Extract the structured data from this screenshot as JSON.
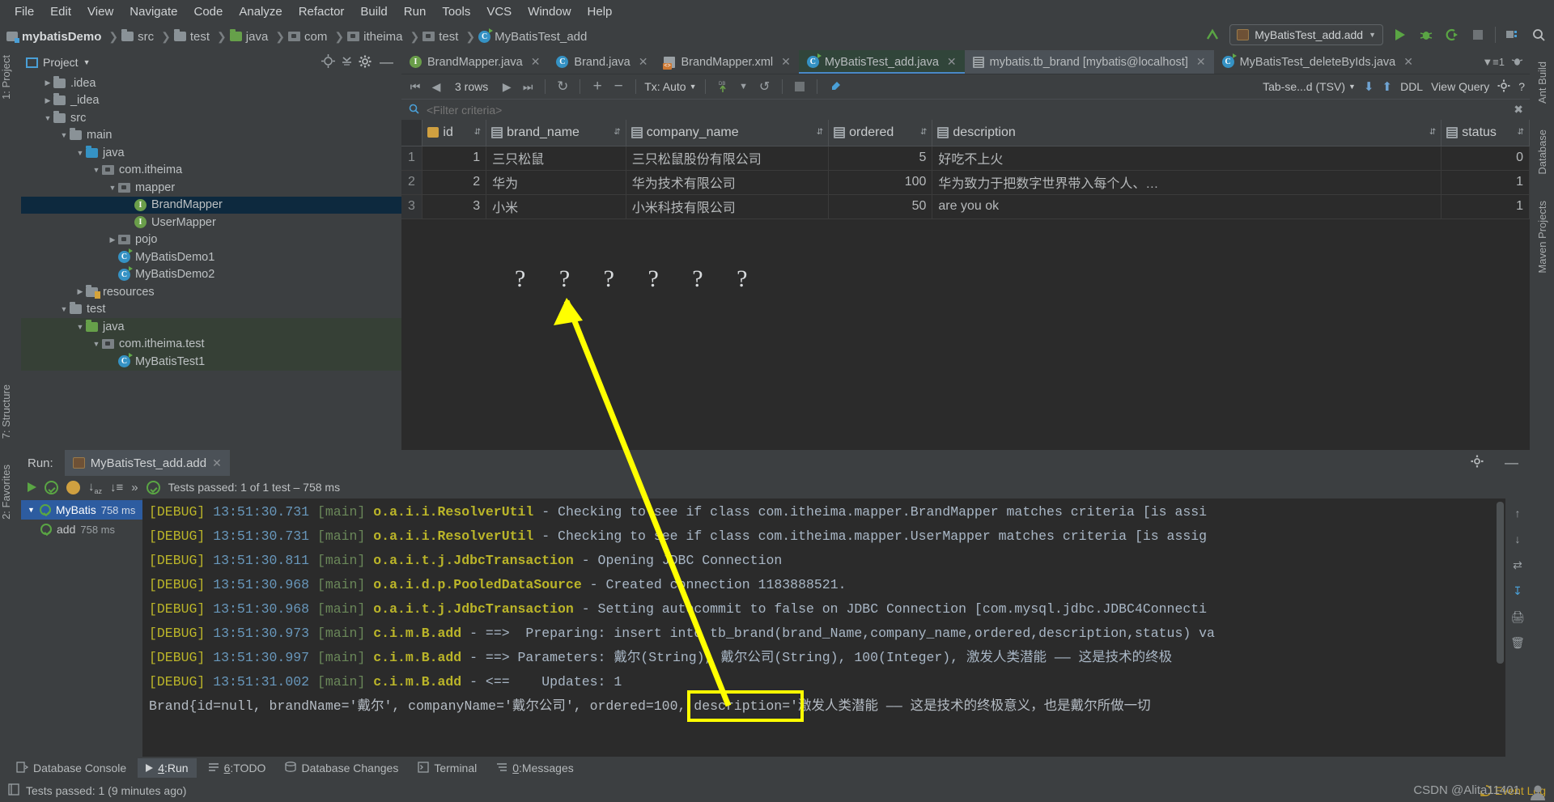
{
  "menubar": {
    "items": [
      "File",
      "Edit",
      "View",
      "Navigate",
      "Code",
      "Analyze",
      "Refactor",
      "Build",
      "Run",
      "Tools",
      "VCS",
      "Window",
      "Help"
    ]
  },
  "breadcrumb": {
    "items": [
      {
        "label": "mybatisDemo",
        "icon": "module-icon"
      },
      {
        "label": "src",
        "icon": "folder-icon"
      },
      {
        "label": "test",
        "icon": "folder-icon"
      },
      {
        "label": "java",
        "icon": "source-folder-icon"
      },
      {
        "label": "com",
        "icon": "package-icon"
      },
      {
        "label": "itheima",
        "icon": "package-icon"
      },
      {
        "label": "test",
        "icon": "package-icon"
      },
      {
        "label": "MyBatisTest_add",
        "icon": "java-class-icon"
      }
    ]
  },
  "toolbar": {
    "run_config": "MyBatisTest_add.add",
    "buttons": [
      "run-button",
      "debug-button",
      "run-coverage-button",
      "stop-button",
      "project-structure-button",
      "search-everywhere-button"
    ]
  },
  "project_panel": {
    "title": "Project",
    "tree": [
      {
        "label": ".idea",
        "depth": 1,
        "arrow": "collapsed",
        "icon": "folder-icon"
      },
      {
        "label": "_idea",
        "depth": 1,
        "arrow": "collapsed",
        "icon": "folder-icon"
      },
      {
        "label": "src",
        "depth": 1,
        "arrow": "expanded",
        "icon": "folder-icon"
      },
      {
        "label": "main",
        "depth": 2,
        "arrow": "expanded",
        "icon": "folder-icon"
      },
      {
        "label": "java",
        "depth": 3,
        "arrow": "expanded",
        "icon": "source-folder-icon"
      },
      {
        "label": "com.itheima",
        "depth": 4,
        "arrow": "expanded",
        "icon": "package-icon"
      },
      {
        "label": "mapper",
        "depth": 5,
        "arrow": "expanded",
        "icon": "package-icon"
      },
      {
        "label": "BrandMapper",
        "depth": 6,
        "arrow": "none",
        "icon": "interface-icon",
        "state": "selected"
      },
      {
        "label": "UserMapper",
        "depth": 6,
        "arrow": "none",
        "icon": "interface-icon"
      },
      {
        "label": "pojo",
        "depth": 5,
        "arrow": "collapsed",
        "icon": "package-icon"
      },
      {
        "label": "MyBatisDemo1",
        "depth": 5,
        "arrow": "none",
        "icon": "java-class-icon"
      },
      {
        "label": "MyBatisDemo2",
        "depth": 5,
        "arrow": "none",
        "icon": "java-class-icon"
      },
      {
        "label": "resources",
        "depth": 3,
        "arrow": "collapsed",
        "icon": "resources-folder-icon"
      },
      {
        "label": "test",
        "depth": 2,
        "arrow": "expanded",
        "icon": "folder-icon"
      },
      {
        "label": "java",
        "depth": 3,
        "arrow": "expanded",
        "icon": "test-source-folder-icon",
        "state": "test"
      },
      {
        "label": "com.itheima.test",
        "depth": 4,
        "arrow": "expanded",
        "icon": "package-icon",
        "state": "test"
      },
      {
        "label": "MyBatisTest1",
        "depth": 5,
        "arrow": "none",
        "icon": "java-class-icon",
        "state": "test"
      }
    ]
  },
  "editor_tabs": [
    {
      "label": "BrandMapper.java",
      "icon": "interface-icon",
      "state": "normal"
    },
    {
      "label": "Brand.java",
      "icon": "class-icon",
      "state": "normal"
    },
    {
      "label": "BrandMapper.xml",
      "icon": "xml-icon",
      "state": "normal"
    },
    {
      "label": "MyBatisTest_add.java",
      "icon": "java-test-icon",
      "state": "active"
    },
    {
      "label": "mybatis.tb_brand [mybatis@localhost]",
      "icon": "db-table-icon",
      "state": "selected"
    },
    {
      "label": "MyBatisTest_deleteByIds.java",
      "icon": "java-test-icon",
      "state": "normal"
    }
  ],
  "tabs_right_badge": "1",
  "db_toolbar": {
    "rows_label": "3 rows",
    "tx_label": "Tx: Auto",
    "tab_separator": "Tab-se...d (TSV)",
    "ddl_label": "DDL",
    "view_query_label": "View Query",
    "filter_placeholder": "<Filter criteria>"
  },
  "db_table": {
    "columns": [
      {
        "name": "id",
        "icon": "primary-key-icon"
      },
      {
        "name": "brand_name",
        "icon": "column-icon"
      },
      {
        "name": "company_name",
        "icon": "column-icon"
      },
      {
        "name": "ordered",
        "icon": "column-icon"
      },
      {
        "name": "description",
        "icon": "column-icon"
      },
      {
        "name": "status",
        "icon": "column-icon"
      }
    ],
    "rows": [
      {
        "n": "1",
        "id": "1",
        "brand_name": "三只松鼠",
        "company_name": "三只松鼠股份有限公司",
        "ordered": "5",
        "description": "好吃不上火",
        "status": "0"
      },
      {
        "n": "2",
        "id": "2",
        "brand_name": "华为",
        "company_name": "华为技术有限公司",
        "ordered": "100",
        "description": "华为致力于把数字世界带入每个人、…",
        "status": "1"
      },
      {
        "n": "3",
        "id": "3",
        "brand_name": "小米",
        "company_name": "小米科技有限公司",
        "ordered": "50",
        "description": "are you ok",
        "status": "1"
      }
    ]
  },
  "annotation": {
    "question_marks": "? ? ? ? ? ?",
    "highlight_text": "Updates: 1",
    "highlight_color": "#ffff00"
  },
  "run_panel": {
    "label": "Run:",
    "tab_title": "MyBatisTest_add.add",
    "status_text": "Tests passed: 1 of 1 test – 758 ms",
    "test_tree": [
      {
        "label": "MyBatis",
        "time": "758 ms",
        "state": "selected",
        "depth": 0
      },
      {
        "label": "add",
        "time": "758 ms",
        "state": "normal",
        "depth": 1
      }
    ],
    "console_lines": [
      {
        "level": "[DEBUG]",
        "time": "13:51:30.731",
        "thread": "[main]",
        "logger": "o.a.i.i.ResolverUtil",
        "msg": "- Checking to see if class com.itheima.mapper.BrandMapper matches criteria [is assi"
      },
      {
        "level": "[DEBUG]",
        "time": "13:51:30.731",
        "thread": "[main]",
        "logger": "o.a.i.i.ResolverUtil",
        "msg": "- Checking to see if class com.itheima.mapper.UserMapper matches criteria [is assig"
      },
      {
        "level": "[DEBUG]",
        "time": "13:51:30.811",
        "thread": "[main]",
        "logger": "o.a.i.t.j.JdbcTransaction",
        "msg": "- Opening JDBC Connection"
      },
      {
        "level": "[DEBUG]",
        "time": "13:51:30.968",
        "thread": "[main]",
        "logger": "o.a.i.d.p.PooledDataSource",
        "msg": "- Created connection 1183888521."
      },
      {
        "level": "[DEBUG]",
        "time": "13:51:30.968",
        "thread": "[main]",
        "logger": "o.a.i.t.j.JdbcTransaction",
        "msg": "- Setting autocommit to false on JDBC Connection [com.mysql.jdbc.JDBC4Connecti"
      },
      {
        "level": "[DEBUG]",
        "time": "13:51:30.973",
        "thread": "[main]",
        "logger": "c.i.m.B.add",
        "msg": "- ==>  Preparing: insert into tb_brand(brand_Name,company_name,ordered,description,status) va"
      },
      {
        "level": "[DEBUG]",
        "time": "13:51:30.997",
        "thread": "[main]",
        "logger": "c.i.m.B.add",
        "msg": "- ==> Parameters: 戴尔(String), 戴尔公司(String), 100(Integer), 激发人类潜能 —— 这是技术的终极"
      },
      {
        "level": "[DEBUG]",
        "time": "13:51:31.002",
        "thread": "[main]",
        "logger": "c.i.m.B.add",
        "msg": "- <==    Updates: 1"
      }
    ],
    "console_last_line": "Brand{id=null, brandName='戴尔', companyName='戴尔公司', ordered=100, description='激发人类潜能 —— 这是技术的终极意义，也是戴尔所做一切"
  },
  "left_tool_strip": [
    "1: Project",
    "7: Structure",
    "2: Favorites"
  ],
  "right_tool_strip": [
    "Ant Build",
    "Database",
    "Maven Projects"
  ],
  "bottom_tool_window_bar": [
    {
      "label": "Database Console",
      "icon": "db-console-icon",
      "mnemonic": "",
      "active": false
    },
    {
      "label": "Run",
      "icon": "run-icon",
      "mnemonic": "4",
      "active": true
    },
    {
      "label": "TODO",
      "icon": "todo-icon",
      "mnemonic": "6",
      "active": false
    },
    {
      "label": "Database Changes",
      "icon": "db-changes-icon",
      "mnemonic": "",
      "active": false
    },
    {
      "label": "Terminal",
      "icon": "terminal-icon",
      "mnemonic": "",
      "active": false
    },
    {
      "label": "Messages",
      "icon": "messages-icon",
      "mnemonic": "0",
      "active": false
    }
  ],
  "status_bar": {
    "message": "Tests passed: 1 (9 minutes ago)",
    "event_log": "Event Log",
    "watermark": "CSDN @Alita11401"
  }
}
